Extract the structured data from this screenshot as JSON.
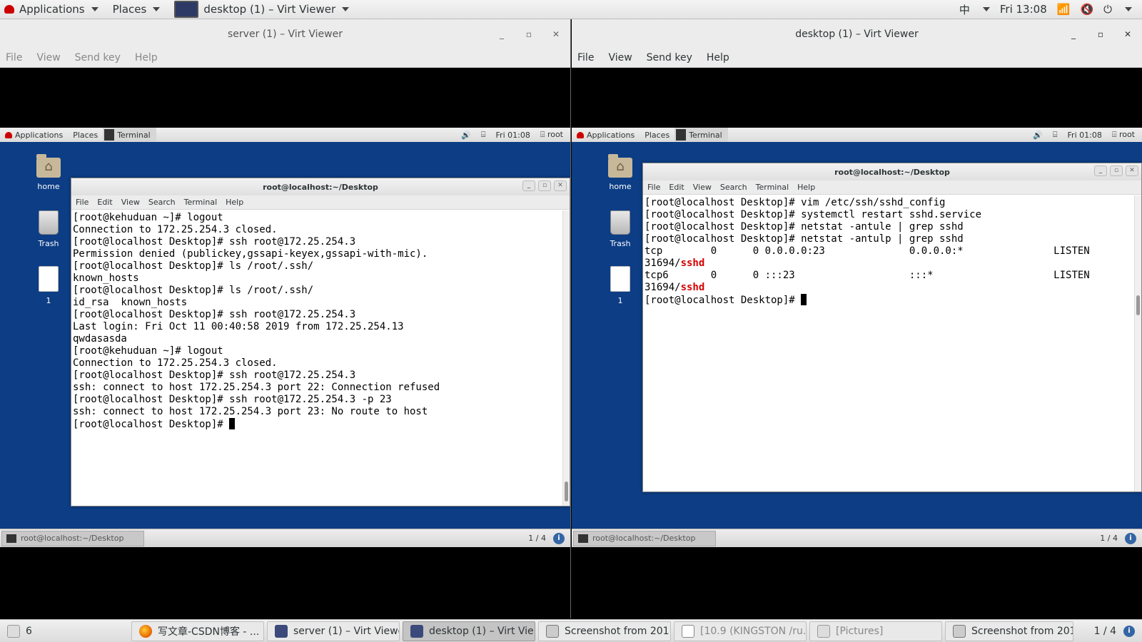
{
  "host_top": {
    "applications": "Applications",
    "places": "Places",
    "active_window": "desktop (1) – Virt Viewer",
    "input_method": "中",
    "clock": "Fri 13:08"
  },
  "left_viewer": {
    "title": "server (1) – Virt Viewer",
    "menu": [
      "File",
      "View",
      "Send key",
      "Help"
    ],
    "guest_top": {
      "applications": "Applications",
      "places": "Places",
      "terminal": "Terminal",
      "clock": "Fri 01:08",
      "user": "root"
    },
    "icons": {
      "home": "home",
      "trash": "Trash",
      "file": "1"
    },
    "terminal": {
      "title": "root@localhost:~/Desktop",
      "menu": [
        "File",
        "Edit",
        "View",
        "Search",
        "Terminal",
        "Help"
      ],
      "lines": [
        "[root@kehuduan ~]# logout",
        "Connection to 172.25.254.3 closed.",
        "[root@localhost Desktop]# ssh root@172.25.254.3",
        "Permission denied (publickey,gssapi-keyex,gssapi-with-mic).",
        "[root@localhost Desktop]# ls /root/.ssh/",
        "known_hosts",
        "[root@localhost Desktop]# ls /root/.ssh/",
        "id_rsa  known_hosts",
        "[root@localhost Desktop]# ssh root@172.25.254.3",
        "Last login: Fri Oct 11 00:40:58 2019 from 172.25.254.13",
        "qwdasasda",
        "[root@kehuduan ~]# logout",
        "Connection to 172.25.254.3 closed.",
        "[root@localhost Desktop]# ssh root@172.25.254.3",
        "ssh: connect to host 172.25.254.3 port 22: Connection refused",
        "[root@localhost Desktop]# ssh root@172.25.254.3 -p 23",
        "ssh: connect to host 172.25.254.3 port 23: No route to host"
      ],
      "prompt": "[root@localhost Desktop]# "
    },
    "taskbar_item": "root@localhost:~/Desktop",
    "pager": "1 / 4"
  },
  "right_viewer": {
    "title": "desktop (1) – Virt Viewer",
    "menu": [
      "File",
      "View",
      "Send key",
      "Help"
    ],
    "guest_top": {
      "applications": "Applications",
      "places": "Places",
      "terminal": "Terminal",
      "clock": "Fri 01:08",
      "user": "root"
    },
    "icons": {
      "home": "home",
      "trash": "Trash",
      "file": "1"
    },
    "terminal": {
      "title": "root@localhost:~/Desktop",
      "menu": [
        "File",
        "Edit",
        "View",
        "Search",
        "Terminal",
        "Help"
      ],
      "lines": [
        "[root@localhost Desktop]# vim /etc/ssh/sshd_config",
        "[root@localhost Desktop]# systemctl restart sshd.service",
        "[root@localhost Desktop]# netstat -antule | grep sshd",
        "[root@localhost Desktop]# netstat -antulp | grep sshd",
        "tcp        0      0 0.0.0.0:23              0.0.0.0:*               LISTEN",
        "31694/",
        "tcp6       0      0 :::23                   :::*                    LISTEN",
        "31694/"
      ],
      "highlight": "sshd",
      "prompt": "[root@localhost Desktop]# "
    },
    "taskbar_item": "root@localhost:~/Desktop",
    "pager": "1 / 4"
  },
  "host_taskbar": {
    "workspace": "6",
    "items": [
      "写文章-CSDN博客 - ...",
      "server (1) – Virt Viewer",
      "desktop (1) – Virt Vie...",
      "Screenshot from 201...",
      "[10.9 (KINGSTON /ru...",
      "[Pictures]",
      "Screenshot from 201..."
    ],
    "pager": "1 / 4"
  },
  "colors": {
    "guest_desktop": "#0c3d85",
    "highlight": "#d40000"
  }
}
